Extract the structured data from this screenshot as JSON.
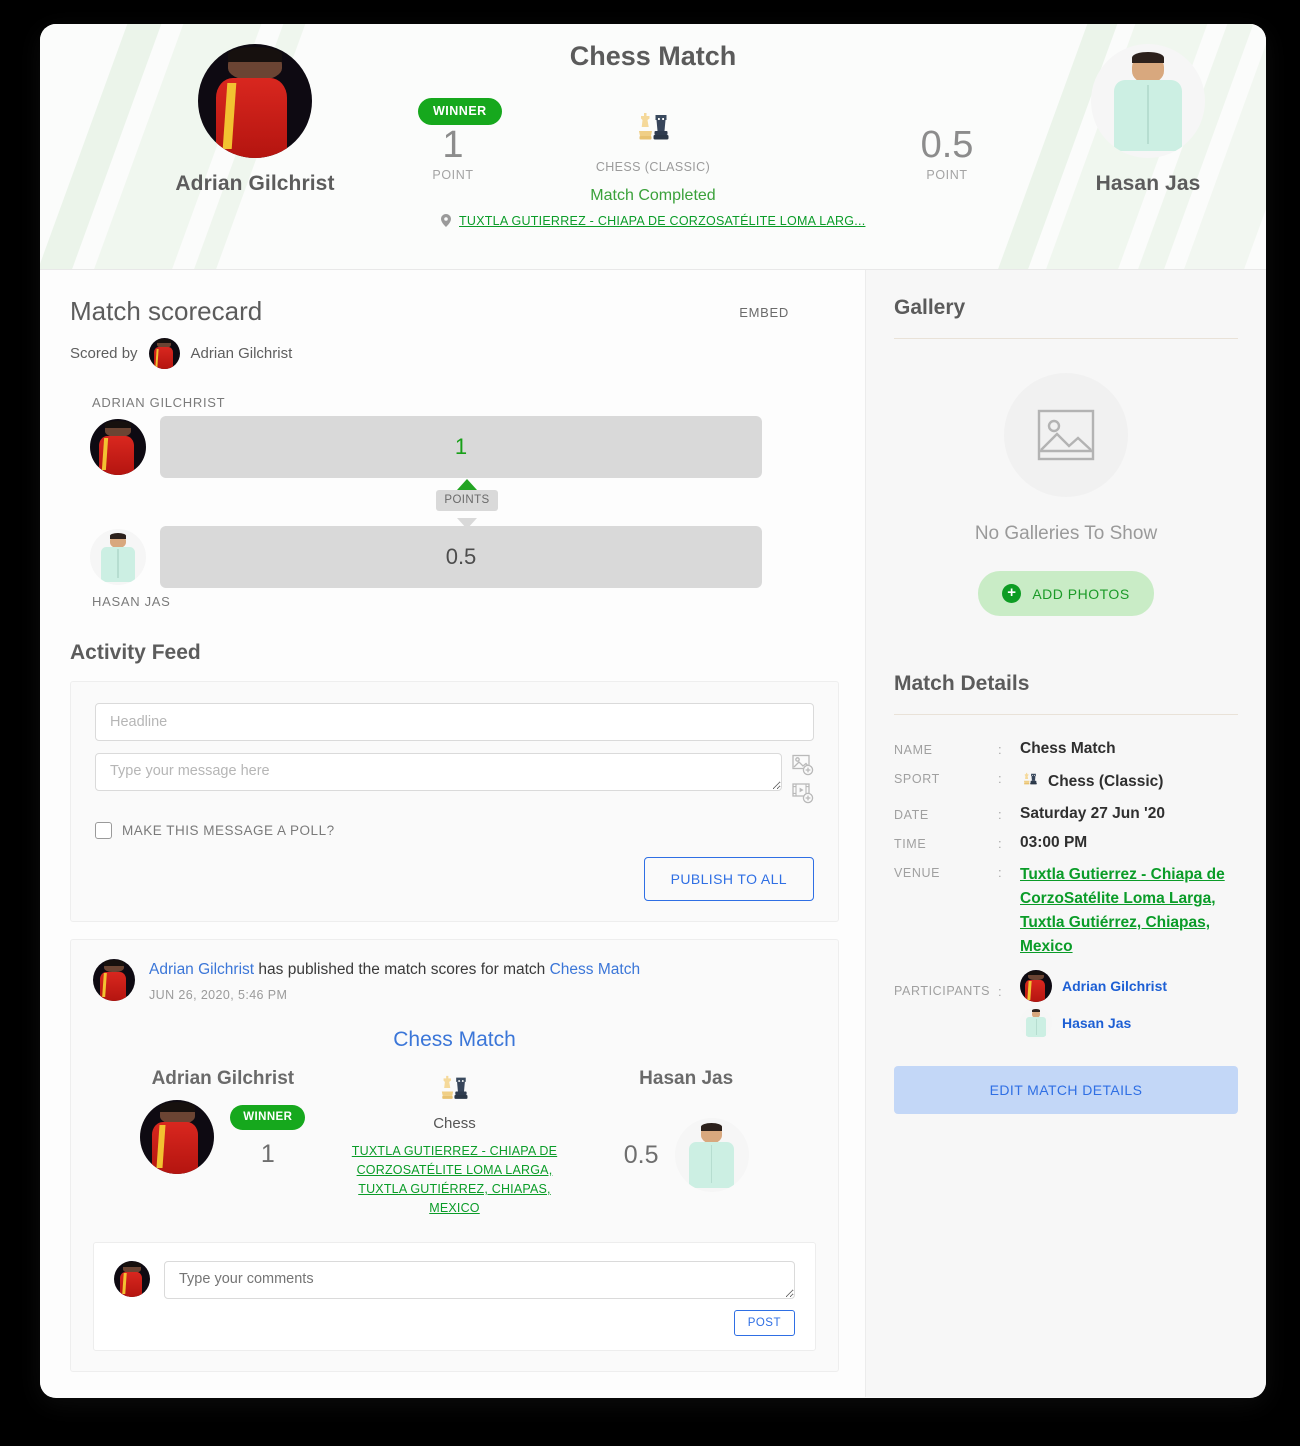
{
  "match": {
    "title": "Chess Match",
    "sport_label": "CHESS (CLASSIC)",
    "sport_name": "Chess",
    "sport_full": "Chess (Classic)",
    "status": "Match Completed",
    "venue_short": "TUXTLA GUTIERREZ - CHIAPA DE CORZOSATÉLITE LOMA LARG...",
    "venue_full": "Tuxtla Gutierrez - Chiapa de CorzoSatélite Loma Larga, Tuxtla Gutiérrez, Chiapas, Mexico",
    "venue_caps": "TUXTLA GUTIERREZ - CHIAPA DE CORZOSATÉLITE LOMA LARGA, TUXTLA GUTIÉRREZ, CHIAPAS, MEXICO",
    "date": "Saturday 27 Jun '20",
    "time": "03:00 PM",
    "winner_badge": "WINNER",
    "point_caption": "POINT"
  },
  "players": {
    "left": {
      "name": "Adrian Gilchrist",
      "name_caps": "ADRIAN GILCHRIST",
      "score": "1"
    },
    "right": {
      "name": "Hasan Jas",
      "name_caps": "HASAN JAS",
      "score": "0.5"
    }
  },
  "scorecard": {
    "title": "Match scorecard",
    "embed_label": "EMBED",
    "scored_by_label": "Scored by",
    "scored_by_name": "Adrian Gilchrist",
    "points_pill": "POINTS"
  },
  "activity": {
    "title": "Activity Feed",
    "headline_placeholder": "Headline",
    "headline_value": "",
    "message_placeholder": "Type your message here",
    "message_value": "",
    "poll_label": "MAKE THIS MESSAGE A POLL?",
    "publish_label": "PUBLISH TO ALL",
    "add_image_icon": "add-image-icon",
    "add_video_icon": "add-video-icon"
  },
  "post": {
    "author": "Adrian Gilchrist",
    "text_middle": " has published the match scores for match ",
    "match_link": "Chess Match",
    "timestamp": "JUN 26, 2020, 5:46 PM",
    "card_title": "Chess Match",
    "comment_placeholder": "Type your comments",
    "comment_value": "",
    "post_label": "POST"
  },
  "gallery": {
    "title": "Gallery",
    "empty_text": "No Galleries To Show",
    "add_photos_label": "ADD PHOTOS",
    "placeholder_icon": "image-placeholder-icon"
  },
  "details": {
    "title": "Match Details",
    "keys": {
      "name": "NAME",
      "sport": "SPORT",
      "date": "DATE",
      "time": "TIME",
      "venue": "VENUE",
      "participants": "PARTICIPANTS"
    },
    "participants": [
      {
        "name": "Adrian Gilchrist"
      },
      {
        "name": "Hasan Jas"
      }
    ],
    "edit_label": "EDIT MATCH DETAILS"
  },
  "colors": {
    "accent_green": "#0a9c28",
    "winner_green": "#16a81d",
    "link_blue": "#3b76d8",
    "button_blue": "#2f6fe4",
    "bar_gray": "#d9d9d9"
  }
}
